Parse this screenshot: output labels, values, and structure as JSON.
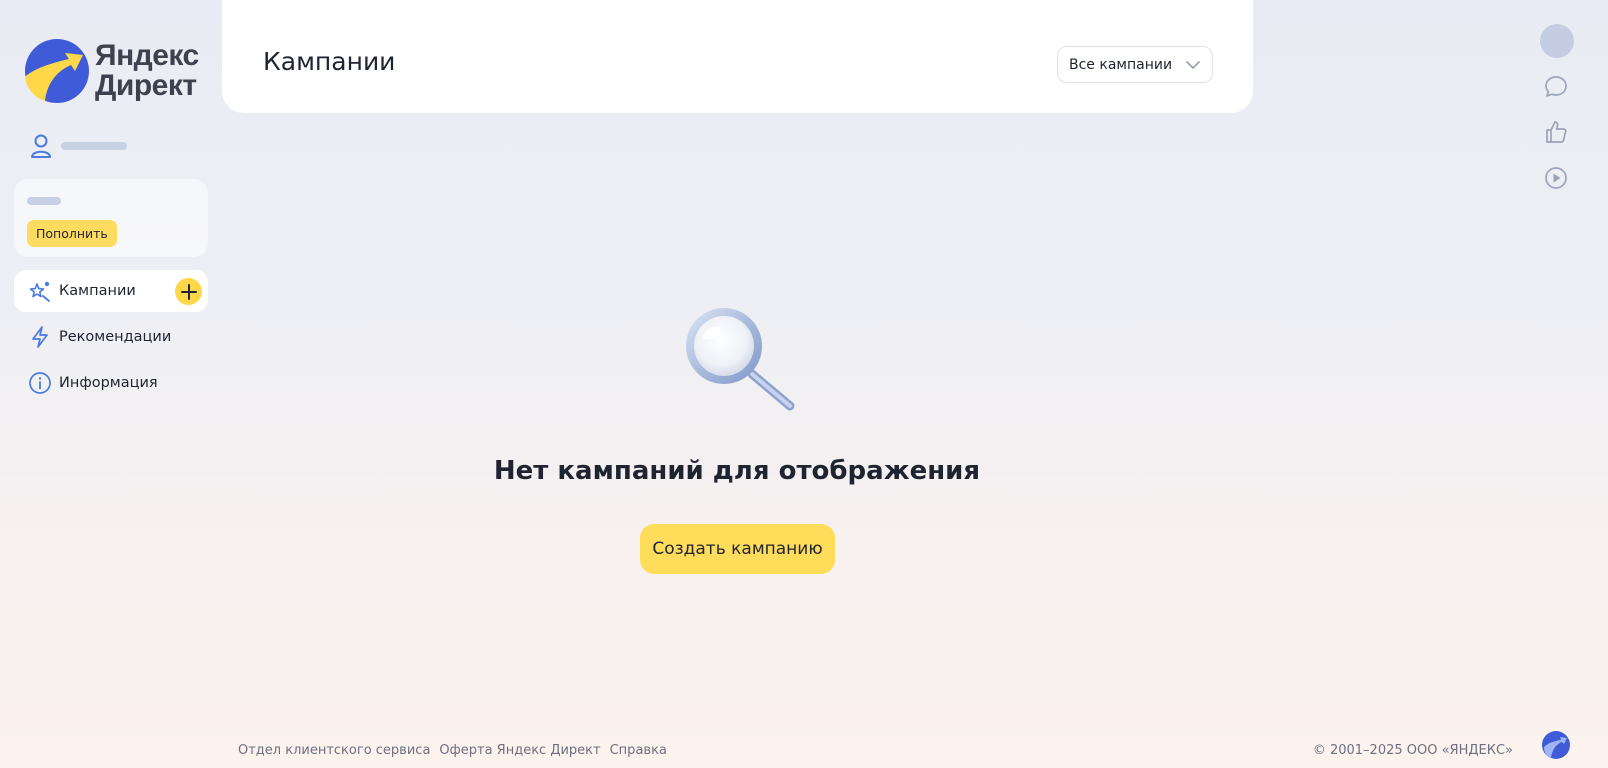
{
  "brand": {
    "name_line1": "Яндекс",
    "name_line2": "Директ",
    "colors": {
      "accent_yellow": "#ffdc5a",
      "logo_blue": "#3f5bd8",
      "icon_blue": "#4a7be0"
    }
  },
  "sidebar": {
    "user_icon": "user-icon",
    "topup_label": "Пополнить",
    "items": [
      {
        "label": "Кампании",
        "icon": "campaigns-sparkle-icon",
        "active": true,
        "has_add": true
      },
      {
        "label": "Рекомендации",
        "icon": "lightning-icon",
        "active": false
      },
      {
        "label": "Информация",
        "icon": "info-icon",
        "active": false
      }
    ]
  },
  "header": {
    "title": "Кампании",
    "filter": {
      "selected": "Все кампании",
      "icon": "chevron-down-icon"
    }
  },
  "right_rail": {
    "icons": [
      "avatar",
      "chat-icon",
      "thumbs-up-icon",
      "play-icon"
    ]
  },
  "empty_state": {
    "icon": "magnifier-icon",
    "title": "Нет кампаний для отображения",
    "button_label": "Создать кампанию"
  },
  "footer": {
    "links": [
      "Отдел клиентского сервиса",
      "Оферта Яндекс Директ",
      "Справка"
    ],
    "copyright": "© 2001–2025 ООО «ЯНДЕКС»"
  }
}
